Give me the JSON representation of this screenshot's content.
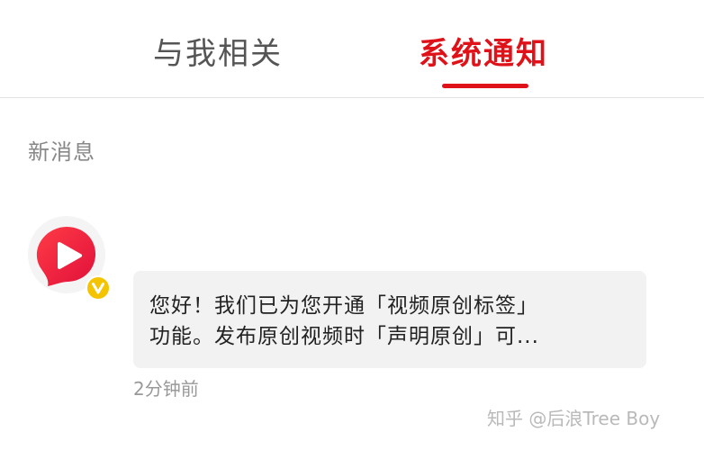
{
  "tabs": {
    "mine_label": "与我相关",
    "system_label": "系统通知"
  },
  "section": {
    "label": "新消息"
  },
  "message": {
    "sender_icon": "video-play-logo-icon",
    "badge_icon": "verified-v-badge-icon",
    "line1": "您好！我们已为您开通「视频原创标签」",
    "line2": "功能。发布原创视频时「声明原创」可...",
    "timestamp": "2分钟前"
  },
  "watermark": {
    "text": "知乎 @后浪Tree Boy"
  },
  "colors": {
    "accent": "#e01219",
    "badge": "#f5c400",
    "bubble_bg": "#f2f2f2"
  }
}
